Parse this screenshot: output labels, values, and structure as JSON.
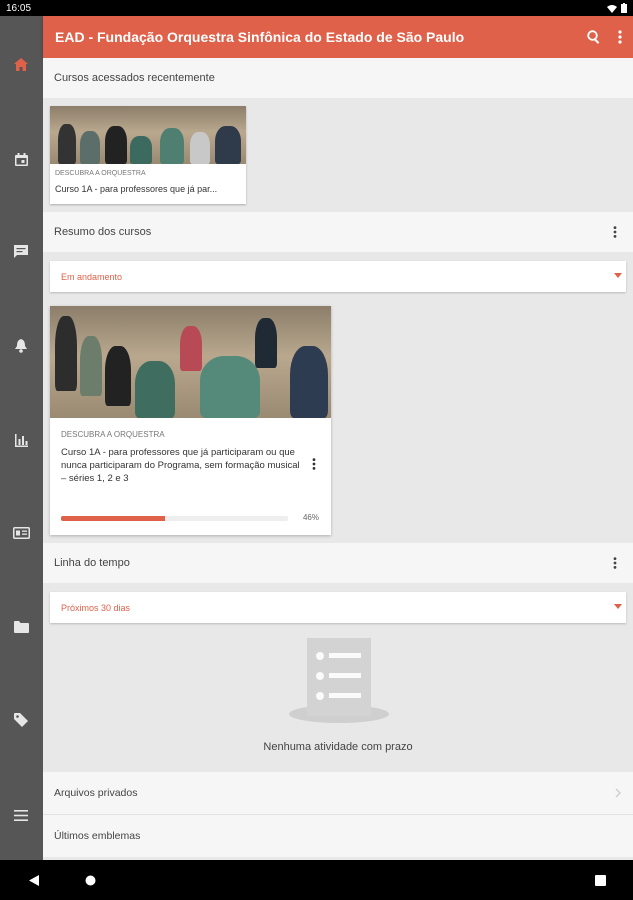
{
  "status_bar": {
    "time": "16:05"
  },
  "app_bar": {
    "title": "EAD - Fundação Orquestra Sinfônica do Estado de São Paulo"
  },
  "recent_courses": {
    "heading": "Cursos acessados recentemente",
    "card": {
      "category": "DESCUBRA A ORQUESTRA",
      "name": "Curso 1A - para professores que já par..."
    }
  },
  "course_overview": {
    "heading": "Resumo dos cursos",
    "filter": "Em andamento",
    "card": {
      "category": "DESCUBRA A ORQUESTRA",
      "name": "Curso 1A - para professores que já participaram ou que nunca participaram do Programa, sem formação musical – séries 1, 2 e 3",
      "progress": 46,
      "progress_label": "46%"
    }
  },
  "timeline": {
    "heading": "Linha do tempo",
    "filter": "Próximos 30 dias",
    "empty_message": "Nenhuma atividade com prazo"
  },
  "private_files": {
    "label": "Arquivos privados"
  },
  "latest_badges": {
    "label": "Últimos emblemas"
  },
  "colors": {
    "accent": "#e0614a",
    "sidebar": "#565656",
    "background": "#e8e8e8"
  },
  "icons": {
    "sidebar": [
      "home-icon",
      "calendar-icon",
      "messages-icon",
      "notifications-icon",
      "grades-icon",
      "badge-card-icon",
      "folder-icon",
      "tag-icon",
      "menu-icon"
    ],
    "app_bar": [
      "search-icon",
      "more-vert-icon"
    ],
    "nav_bar": [
      "back-icon",
      "home-icon",
      "recents-icon"
    ]
  }
}
